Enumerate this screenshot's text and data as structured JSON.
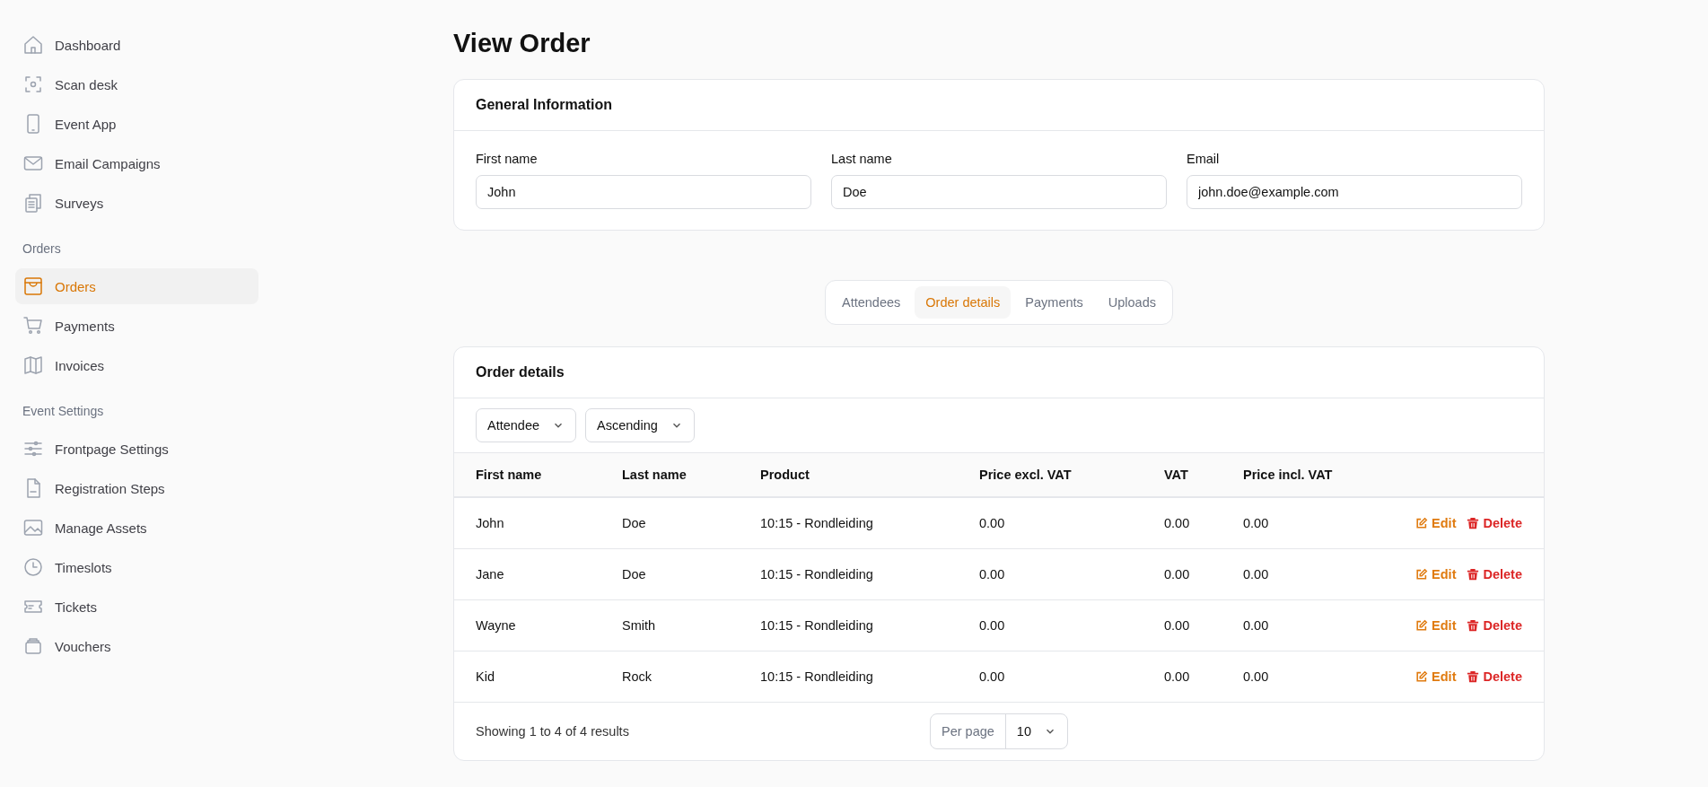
{
  "sidebar": {
    "sections": [
      {
        "items": [
          {
            "label": "Dashboard",
            "selected": false
          },
          {
            "label": "Scan desk",
            "selected": false
          },
          {
            "label": "Event App",
            "selected": false
          },
          {
            "label": "Email Campaigns",
            "selected": false
          },
          {
            "label": "Surveys",
            "selected": false
          }
        ]
      },
      {
        "heading": "Orders",
        "items": [
          {
            "label": "Orders",
            "selected": true
          },
          {
            "label": "Payments",
            "selected": false
          },
          {
            "label": "Invoices",
            "selected": false
          }
        ]
      },
      {
        "heading": "Event Settings",
        "items": [
          {
            "label": "Frontpage Settings",
            "selected": false
          },
          {
            "label": "Registration Steps",
            "selected": false
          },
          {
            "label": "Manage Assets",
            "selected": false
          },
          {
            "label": "Timeslots",
            "selected": false
          },
          {
            "label": "Tickets",
            "selected": false
          },
          {
            "label": "Vouchers",
            "selected": false
          }
        ]
      }
    ]
  },
  "page_title": "View Order",
  "general_information": {
    "title": "General Information",
    "fields": [
      {
        "label": "First name",
        "value": "John"
      },
      {
        "label": "Last name",
        "value": "Doe"
      },
      {
        "label": "Email",
        "value": "john.doe@example.com"
      }
    ]
  },
  "tabs": [
    {
      "label": "Attendees",
      "selected": false
    },
    {
      "label": "Order details",
      "selected": true
    },
    {
      "label": "Payments",
      "selected": false
    },
    {
      "label": "Uploads",
      "selected": false
    }
  ],
  "order_details": {
    "title": "Order details",
    "filters": [
      "Attendee",
      "Ascending"
    ],
    "table": {
      "columns": [
        "First name",
        "Last name",
        "Product",
        "Price excl. VAT",
        "VAT",
        "Price incl. VAT"
      ],
      "rows": [
        {
          "cells": [
            "John",
            "Doe",
            "10:15 - Rondleiding",
            "0.00",
            "0.00",
            "0.00"
          ],
          "actions": [
            "Edit",
            "Delete"
          ]
        },
        {
          "cells": [
            "Jane",
            "Doe",
            "10:15 - Rondleiding",
            "0.00",
            "0.00",
            "0.00"
          ],
          "actions": [
            "Edit",
            "Delete"
          ]
        },
        {
          "cells": [
            "Wayne",
            "Smith",
            "10:15 - Rondleiding",
            "0.00",
            "0.00",
            "0.00"
          ],
          "actions": [
            "Edit",
            "Delete"
          ]
        },
        {
          "cells": [
            "Kid",
            "Rock",
            "10:15 - Rondleiding",
            "0.00",
            "0.00",
            "0.00"
          ],
          "actions": [
            "Edit",
            "Delete"
          ]
        }
      ]
    },
    "summary": "Showing 1 to 4 of 4 results",
    "per_page": {
      "label": "Per page",
      "value": "10"
    }
  }
}
